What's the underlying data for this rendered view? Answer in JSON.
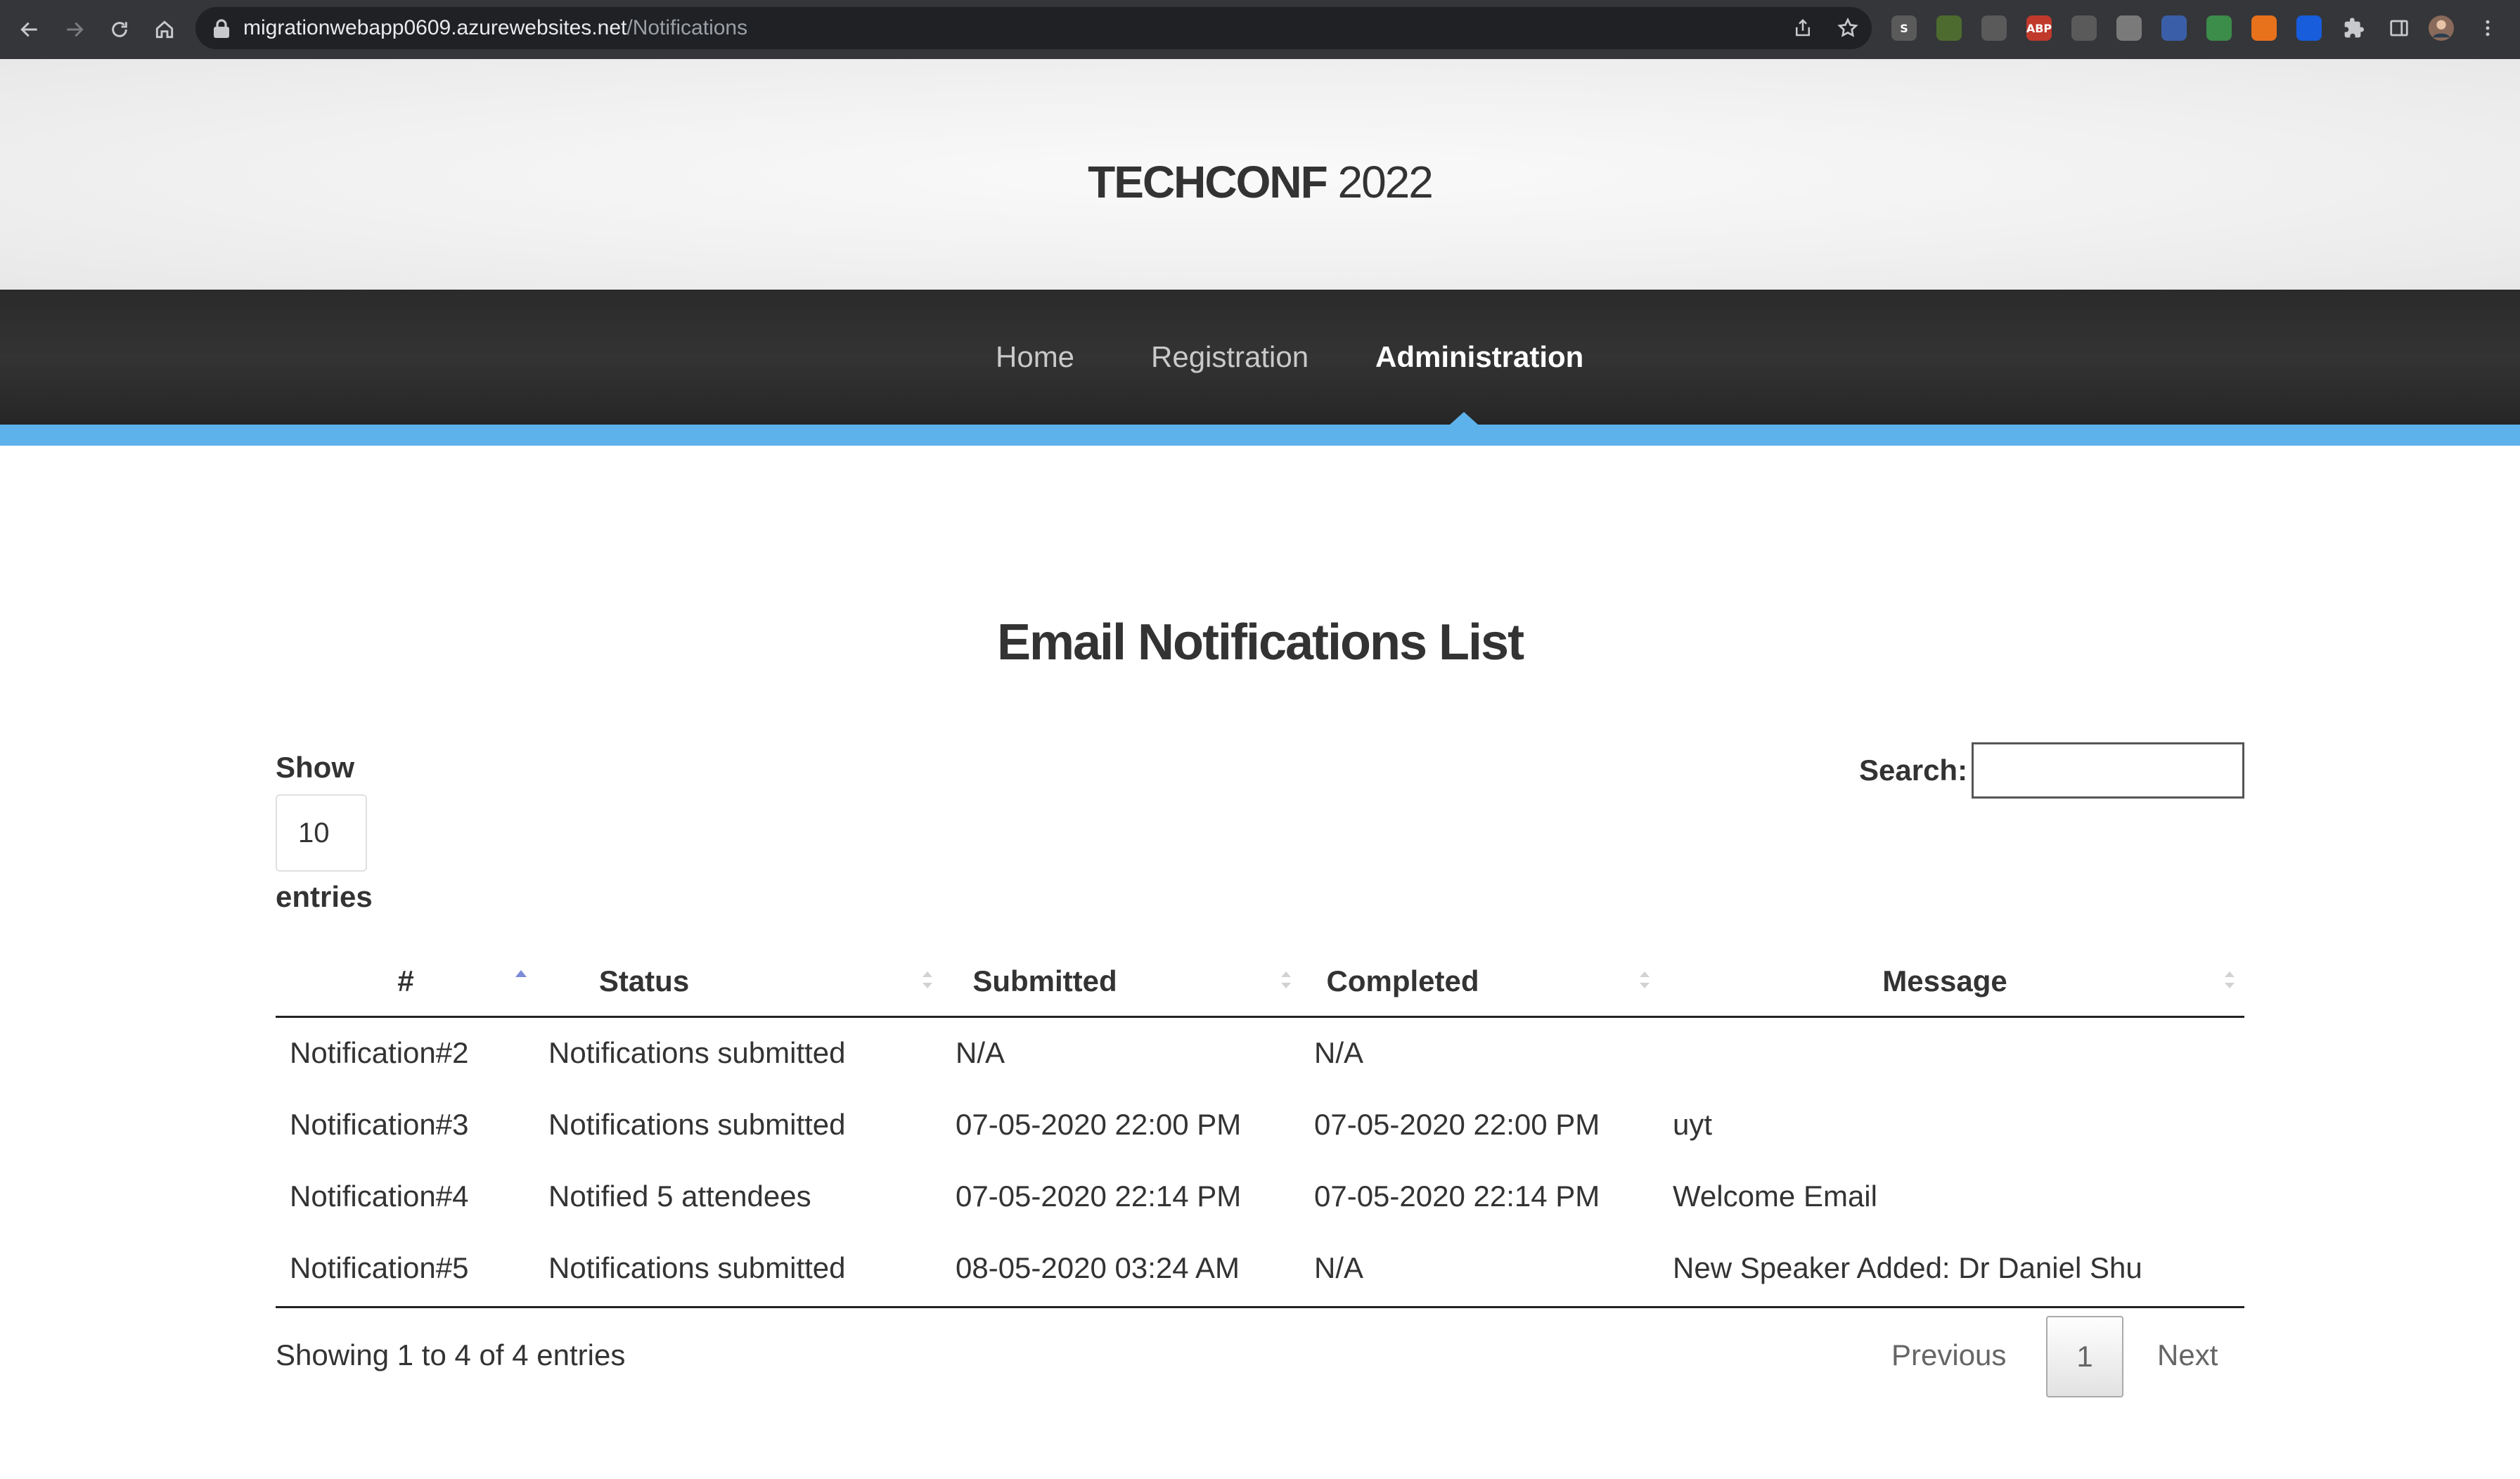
{
  "browser": {
    "url_host": "migrationwebapp0609.azurewebsites.net",
    "url_path": "/Notifications",
    "extensions": [
      {
        "name": "skype-extension-icon",
        "label": "S",
        "color": "#5a5a5a"
      },
      {
        "name": "tampermonkey-icon",
        "label": "",
        "color": "#4d6b2f"
      },
      {
        "name": "extension-glasses-icon",
        "label": "",
        "color": "#5a5a5a"
      },
      {
        "name": "adblock-plus-icon",
        "label": "ABP",
        "color": "#c0392b"
      },
      {
        "name": "pen-extension-icon",
        "label": "",
        "color": "#5a5a5a"
      },
      {
        "name": "extension-eyes-icon",
        "label": "",
        "color": "#7a7a7a"
      },
      {
        "name": "feather-extension-icon",
        "label": "",
        "color": "#3a5fa8"
      },
      {
        "name": "android-extension-icon",
        "label": "",
        "color": "#3c8c4a"
      },
      {
        "name": "orange-extension-icon",
        "label": "",
        "color": "#e8711c"
      },
      {
        "name": "bitwarden-icon",
        "label": "",
        "color": "#175ddc"
      }
    ]
  },
  "site": {
    "logo_brand": "TECHCONF",
    "logo_year": " 2022",
    "nav": {
      "home": "Home",
      "registration": "Registration",
      "administration": "Administration",
      "active": "administration"
    },
    "accent_color": "#5db2ec"
  },
  "page": {
    "title": "Email Notifications List",
    "show_label": "Show",
    "length_value": "10",
    "entries_label": "entries",
    "search_label": "Search:",
    "search_value": ""
  },
  "table": {
    "columns": [
      "#",
      "Status",
      "Submitted",
      "Completed",
      "Message"
    ],
    "sorted_column": "#",
    "sort_direction": "ascending",
    "rows": [
      {
        "id": "Notification#2",
        "status": "Notifications submitted",
        "submitted": "N/A",
        "completed": "N/A",
        "message": ""
      },
      {
        "id": "Notification#3",
        "status": "Notifications submitted",
        "submitted": "07-05-2020 22:00 PM",
        "completed": "07-05-2020 22:00 PM",
        "message": "uyt"
      },
      {
        "id": "Notification#4",
        "status": "Notified 5 attendees",
        "submitted": "07-05-2020 22:14 PM",
        "completed": "07-05-2020 22:14 PM",
        "message": "Welcome Email"
      },
      {
        "id": "Notification#5",
        "status": "Notifications submitted",
        "submitted": "08-05-2020 03:24 AM",
        "completed": "N/A",
        "message": "New Speaker Added: Dr Daniel Shu"
      }
    ]
  },
  "pagination": {
    "info": "Showing 1 to 4 of 4 entries",
    "previous": "Previous",
    "current_page": "1",
    "next": "Next"
  }
}
